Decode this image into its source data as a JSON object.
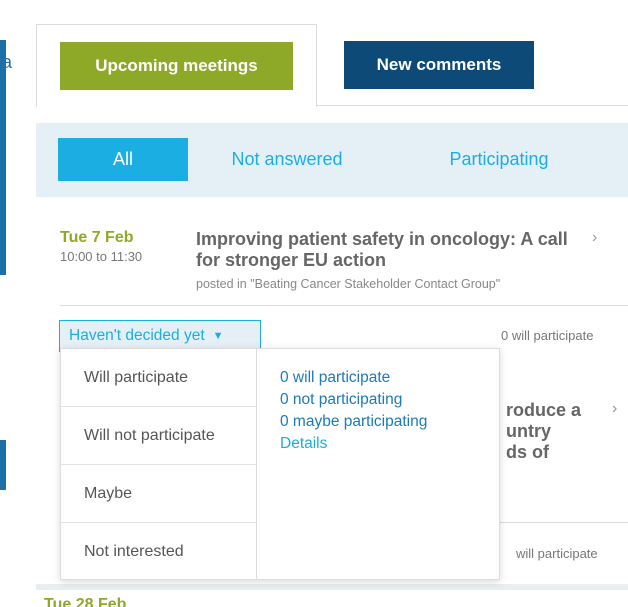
{
  "tabs": {
    "upcoming_label": "Upcoming meetings",
    "comments_label": "New comments"
  },
  "filters": {
    "all": "All",
    "not_answered": "Not answered",
    "participating": "Participating"
  },
  "meeting": {
    "date": "Tue 7 Feb",
    "time": "10:00 to 11:30",
    "title": "Improving patient safety in oncology: A call for stronger EU action",
    "posted": "posted in \"Beating Cancer Stakeholder Contact Group\"",
    "rsvp_label": "Haven't decided yet",
    "participation_count": "0 will participate"
  },
  "meeting2": {
    "title_fragment_1": "roduce a",
    "title_fragment_2": "untry",
    "title_fragment_3": "ds of",
    "participation_count": "will participate"
  },
  "next_meeting": {
    "date_fragment": "Tue 28 Feb"
  },
  "dropdown": {
    "options": [
      "Will participate",
      "Will not participate",
      "Maybe",
      "Not interested"
    ],
    "stats": [
      "0 will participate",
      "0 not participating",
      "0 maybe participating"
    ],
    "details_label": "Details"
  },
  "left_edge_letter": "a",
  "colors": {
    "upcoming_green": "#8ea828",
    "comments_navy": "#0d4a78",
    "accent_cyan": "#1aaee3",
    "filter_bg": "#e5f0f6"
  }
}
